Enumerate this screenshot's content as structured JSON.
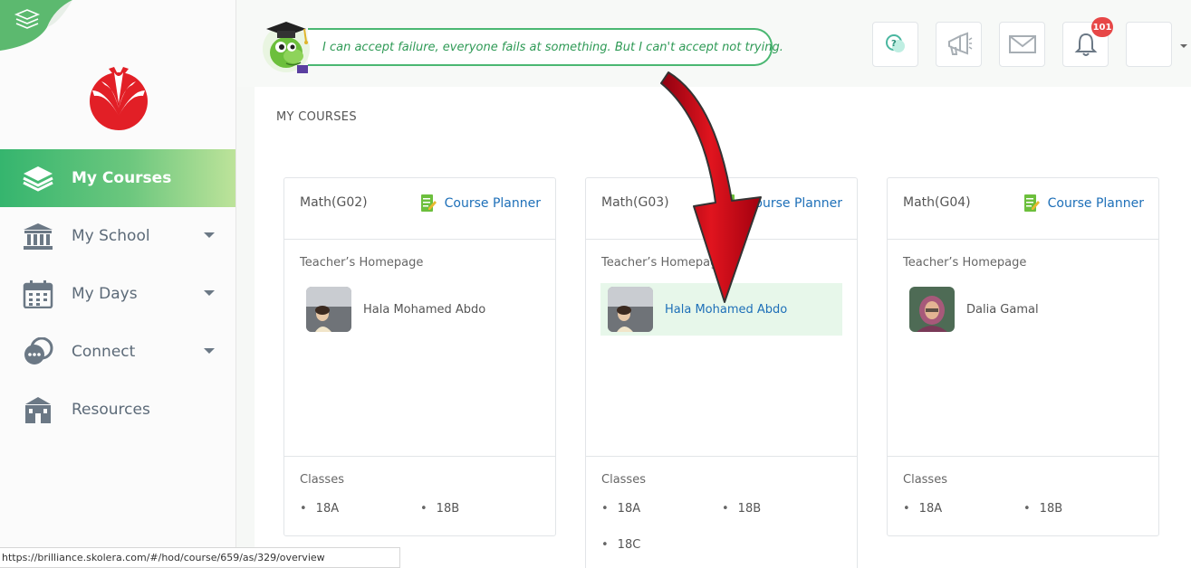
{
  "sidebar": {
    "items": [
      {
        "label": "My Courses",
        "icon": "layers-icon",
        "active": true
      },
      {
        "label": "My School",
        "icon": "school-building-icon",
        "has_caret": true
      },
      {
        "label": "My Days",
        "icon": "calendar-icon",
        "has_caret": true
      },
      {
        "label": "Connect",
        "icon": "chat-bubbles-icon",
        "has_caret": true
      },
      {
        "label": "Resources",
        "icon": "library-icon"
      }
    ],
    "active_gradient": [
      "#35b56e",
      "#bde39a"
    ]
  },
  "topbar": {
    "quote": "I can accept failure, everyone fails at something. But I can't accept not trying.",
    "buttons": [
      "help-chat-icon",
      "megaphone-icon",
      "mail-icon",
      "bell-icon",
      "avatar"
    ],
    "notification_count": "101"
  },
  "main": {
    "section_title": "MY COURSES",
    "courses": [
      {
        "title": "Math(G02)",
        "planner_label": "Course Planner",
        "homepage_label": "Teacher’s Homepage",
        "teacher": "Hala Mohamed Abdo",
        "classes_label": "Classes",
        "classes": [
          "18A",
          "18B"
        ]
      },
      {
        "title": "Math(G03)",
        "planner_label": "Course Planner",
        "homepage_label": "Teacher’s Homepage",
        "teacher": "Hala Mohamed Abdo",
        "classes_label": "Classes",
        "classes": [
          "18A",
          "18B",
          "18C"
        ],
        "highlighted": true
      },
      {
        "title": "Math(G04)",
        "planner_label": "Course Planner",
        "homepage_label": "Teacher’s Homepage",
        "teacher": "Dalia Gamal",
        "classes_label": "Classes",
        "classes": [
          "18A",
          "18B"
        ]
      }
    ]
  },
  "statusbar": {
    "url": "https://brilliance.skolera.com/#/hod/course/659/as/329/overview"
  },
  "colors": {
    "accent_green": "#35b56e",
    "link_blue": "#1d6fb8",
    "badge_red": "#e74747",
    "arrow_red": "#d0021b"
  }
}
